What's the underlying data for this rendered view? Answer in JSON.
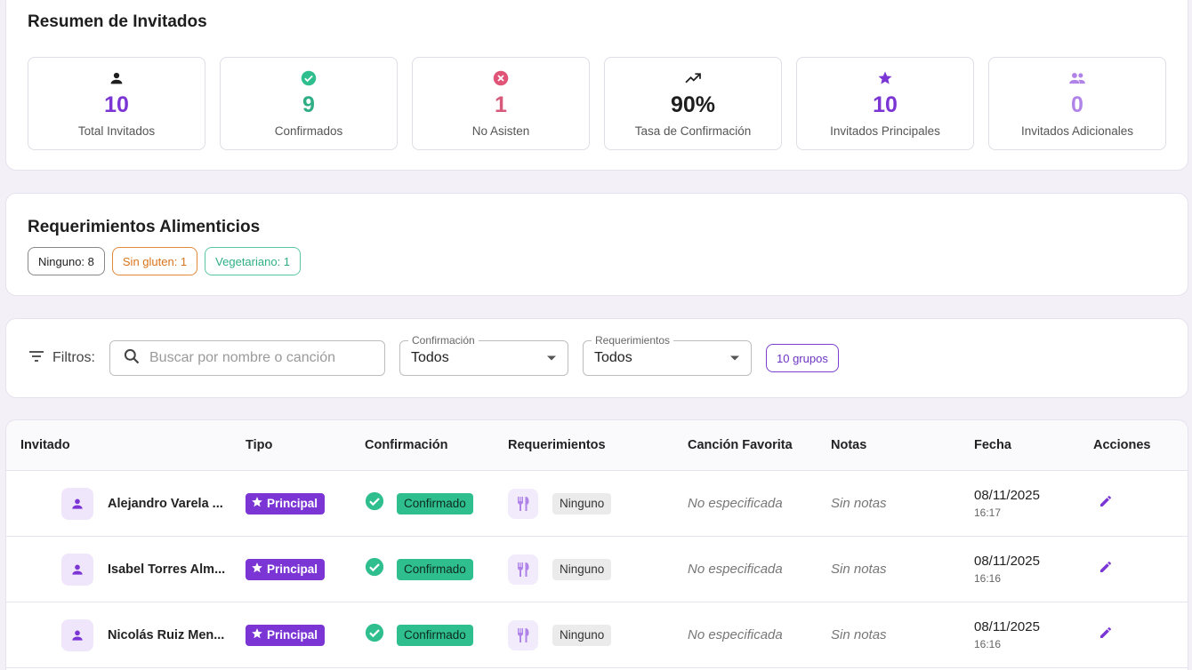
{
  "summary": {
    "title": "Resumen de Invitados",
    "stats": [
      {
        "icon": "person-icon",
        "value": "10",
        "label": "Total Invitados",
        "color": "#7b35d5",
        "icon_color": "#1e1e1e"
      },
      {
        "icon": "check-circle-icon",
        "value": "9",
        "label": "Confirmados",
        "color": "#2fae86",
        "icon_color": "#2fbf8f"
      },
      {
        "icon": "cancel-circle-icon",
        "value": "1",
        "label": "No Asisten",
        "color": "#d85a7a",
        "icon_color": "#e05478"
      },
      {
        "icon": "trending-up-icon",
        "value": "90%",
        "label": "Tasa de Confirmación",
        "color": "#1e1e1e",
        "icon_color": "#1e1e1e"
      },
      {
        "icon": "star-icon",
        "value": "10",
        "label": "Invitados Principales",
        "color": "#7b35d5",
        "icon_color": "#7b35d5"
      },
      {
        "icon": "group-icon",
        "value": "0",
        "label": "Invitados Adicionales",
        "color": "#b083e8",
        "icon_color": "#b083e8"
      }
    ]
  },
  "diet": {
    "title": "Requerimientos Alimenticios",
    "chips": [
      {
        "label": "Ninguno: 8",
        "color": "#222222",
        "border": "#888888"
      },
      {
        "label": "Sin gluten: 1",
        "color": "#d9731a",
        "border": "#e08a3a"
      },
      {
        "label": "Vegetariano: 1",
        "color": "#2fae86",
        "border": "#5cc6a4"
      }
    ]
  },
  "filters": {
    "label": "Filtros:",
    "search_placeholder": "Buscar por nombre o canción",
    "confirm_legend": "Confirmación",
    "confirm_value": "Todos",
    "req_legend": "Requerimientos",
    "req_value": "Todos",
    "groups_badge": "10 grupos"
  },
  "table": {
    "headers": {
      "guest": "Invitado",
      "type": "Tipo",
      "confirmation": "Confirmación",
      "requirements": "Requerimientos",
      "song": "Canción Favorita",
      "notes": "Notas",
      "date": "Fecha",
      "actions": "Acciones"
    },
    "rows": [
      {
        "name": "Alejandro Varela ...",
        "type": "Principal",
        "confirmation": "Confirmado",
        "requirement": "Ninguno",
        "song": "No especificada",
        "notes": "Sin notas",
        "date": "08/11/2025",
        "time": "16:17"
      },
      {
        "name": "Isabel Torres Alm...",
        "type": "Principal",
        "confirmation": "Confirmado",
        "requirement": "Ninguno",
        "song": "No especificada",
        "notes": "Sin notas",
        "date": "08/11/2025",
        "time": "16:16"
      },
      {
        "name": "Nicolás Ruiz Men...",
        "type": "Principal",
        "confirmation": "Confirmado",
        "requirement": "Ninguno",
        "song": "No especificada",
        "notes": "Sin notas",
        "date": "08/11/2025",
        "time": "16:16"
      }
    ]
  }
}
